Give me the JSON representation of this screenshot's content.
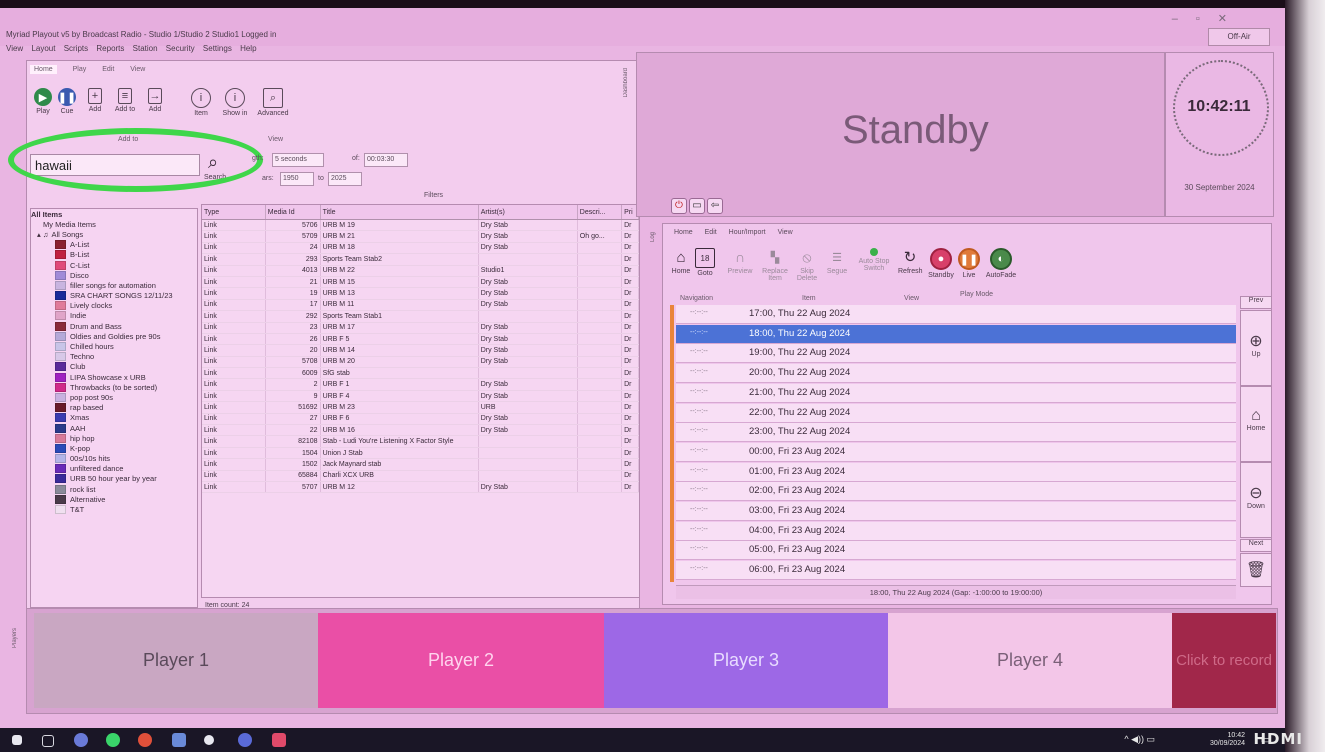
{
  "window": {
    "title": "Myriad Playout v5 by Broadcast Radio - Studio 1/Studio 2 Studio1 Logged in",
    "menu": [
      "View",
      "Layout",
      "Scripts",
      "Reports",
      "Station",
      "Security",
      "Settings",
      "Help"
    ],
    "off_air": "Off-Air"
  },
  "ribbon": {
    "tabs": [
      "Home",
      "Play",
      "Edit",
      "View"
    ],
    "buttons": [
      "Play",
      "Cue",
      "Add",
      "Add to",
      "Add",
      "Item",
      "Show in",
      "Advanced"
    ],
    "buttons_sub": [
      "",
      "",
      "",
      "",
      "",
      "Information",
      "SmartInfo",
      "Search"
    ],
    "groups": [
      "Add to",
      "View"
    ]
  },
  "search": {
    "value": "hawaii",
    "button_label": "Search",
    "all_items_label": "All Items"
  },
  "filters": {
    "length_label": "gth:",
    "length_value": "5 seconds",
    "of_label": "of:",
    "of_value": "00:03:30",
    "years_label": "ars:",
    "year_from": "1950",
    "to_label": "to",
    "year_to": "2025",
    "title": "Filters"
  },
  "tree": {
    "root": "All Items",
    "my_media": "My Media Items",
    "all_songs": "All Songs",
    "items": [
      {
        "label": "A-List",
        "color": "#8a2030"
      },
      {
        "label": "B-List",
        "color": "#c02040"
      },
      {
        "label": "C-List",
        "color": "#e04a7a"
      },
      {
        "label": "Disco",
        "color": "#a08ad8"
      },
      {
        "label": "filler songs for automation",
        "color": "#c8b4e0"
      },
      {
        "label": "SRA CHART SONGS 12/11/23",
        "color": "#1a2a9a"
      },
      {
        "label": "Lively clocks",
        "color": "#e07a9a"
      },
      {
        "label": "Indie",
        "color": "#e0a4c8"
      },
      {
        "label": "Drum and Bass",
        "color": "#8a2a3a"
      },
      {
        "label": "Oldies and Goldies pre 90s",
        "color": "#b4a8d8"
      },
      {
        "label": "Chilled hours",
        "color": "#c8c4e8"
      },
      {
        "label": "Techno",
        "color": "#d8c8e8"
      },
      {
        "label": "Club",
        "color": "#5a2a9a"
      },
      {
        "label": "LIPA Showcase x URB",
        "color": "#a020c0"
      },
      {
        "label": "Throwbacks (to be sorted)",
        "color": "#d02a8a"
      },
      {
        "label": "pop post 90s",
        "color": "#c8b0e0"
      },
      {
        "label": "rap based",
        "color": "#6a1a2a"
      },
      {
        "label": "Xmas",
        "color": "#3a3ab0"
      },
      {
        "label": "AAH",
        "color": "#2a3a8a"
      },
      {
        "label": "hip hop",
        "color": "#d87a9a"
      },
      {
        "label": "K-pop",
        "color": "#2a4ab8"
      },
      {
        "label": "00s/10s hits",
        "color": "#b4b4e8"
      },
      {
        "label": "unfiltered dance",
        "color": "#6a2ab8"
      },
      {
        "label": "URB 50 hour year by year",
        "color": "#3a2a9a"
      },
      {
        "label": "rock list",
        "color": "#8a8a9a"
      },
      {
        "label": "Alternative",
        "color": "#4a3a4a"
      },
      {
        "label": "T&T",
        "color": "#f0e0f0"
      }
    ]
  },
  "grid": {
    "columns": [
      "Type",
      "Media Id",
      "Title",
      "Artist(s)",
      "Descri...",
      "Pri"
    ],
    "rows": [
      [
        "Link",
        "5706",
        "URB M 19",
        "Dry Stab",
        "",
        "Dr"
      ],
      [
        "Link",
        "5709",
        "URB M 21",
        "Dry Stab",
        "Oh go...",
        "Dr"
      ],
      [
        "Link",
        "24",
        "URB M 18",
        "Dry Stab",
        "",
        "Dr"
      ],
      [
        "Link",
        "293",
        "Sports Team Stab2",
        "",
        "",
        "Dr"
      ],
      [
        "Link",
        "4013",
        "URB M 22",
        "Studio1",
        "",
        "Dr"
      ],
      [
        "Link",
        "21",
        "URB M 15",
        "Dry Stab",
        "",
        "Dr"
      ],
      [
        "Link",
        "19",
        "URB M 13",
        "Dry Stab",
        "",
        "Dr"
      ],
      [
        "Link",
        "17",
        "URB M 11",
        "Dry Stab",
        "",
        "Dr"
      ],
      [
        "Link",
        "292",
        "Sports Team Stab1",
        "",
        "",
        "Dr"
      ],
      [
        "Link",
        "23",
        "URB M 17",
        "Dry Stab",
        "",
        "Dr"
      ],
      [
        "Link",
        "26",
        "URB F 5",
        "Dry Stab",
        "",
        "Dr"
      ],
      [
        "Link",
        "20",
        "URB M 14",
        "Dry Stab",
        "",
        "Dr"
      ],
      [
        "Link",
        "5708",
        "URB M 20",
        "Dry Stab",
        "",
        "Dr"
      ],
      [
        "Link",
        "6009",
        "SfG stab",
        "",
        "",
        "Dr"
      ],
      [
        "Link",
        "2",
        "URB F 1",
        "Dry Stab",
        "",
        "Dr"
      ],
      [
        "Link",
        "9",
        "URB F 4",
        "Dry Stab",
        "",
        "Dr"
      ],
      [
        "Link",
        "51692",
        "URB M 23",
        "URB",
        "",
        "Dr"
      ],
      [
        "Link",
        "27",
        "URB F 6",
        "Dry Stab",
        "",
        "Dr"
      ],
      [
        "Link",
        "22",
        "URB M 16",
        "Dry Stab",
        "",
        "Dr"
      ],
      [
        "Link",
        "82108",
        "Stab - Ludi You're Listening X Factor Style",
        "",
        "",
        "Dr"
      ],
      [
        "Link",
        "1504",
        "Union J Stab",
        "",
        "",
        "Dr"
      ],
      [
        "Link",
        "1502",
        "Jack Maynard stab",
        "",
        "",
        "Dr"
      ],
      [
        "Link",
        "65884",
        "Charli XCX URB",
        "",
        "",
        "Dr"
      ],
      [
        "Link",
        "5707",
        "URB M 12",
        "Dry Stab",
        "",
        "Dr"
      ]
    ],
    "item_count": "Item count: 24"
  },
  "dashboard": {
    "tab": "Dashboard",
    "status": "Standby",
    "clock_time": "10:42:11",
    "clock_date": "30 September 2024"
  },
  "log": {
    "tab": "Log",
    "ribbon_tabs": [
      "Home",
      "Edit",
      "Hour/Import",
      "View"
    ],
    "ribbon_buttons": [
      "Home",
      "Goto",
      "Preview",
      "Replace Item",
      "Skip Delete",
      "Segue",
      "Auto Stop Switch",
      "Refresh",
      "Standby",
      "Live",
      "AutoFade"
    ],
    "ribbon_groups": [
      "Navigation",
      "Item",
      "View",
      "Play Mode"
    ],
    "placeholder_time": "--:--:--",
    "rows": [
      "17:00, Thu 22 Aug 2024",
      "18:00, Thu 22 Aug 2024",
      "19:00, Thu 22 Aug 2024",
      "20:00, Thu 22 Aug 2024",
      "21:00, Thu 22 Aug 2024",
      "22:00, Thu 22 Aug 2024",
      "23:00, Thu 22 Aug 2024",
      "00:00, Fri 23 Aug 2024",
      "01:00, Fri 23 Aug 2024",
      "02:00, Fri 23 Aug 2024",
      "03:00, Fri 23 Aug 2024",
      "04:00, Fri 23 Aug 2024",
      "05:00, Fri 23 Aug 2024",
      "06:00, Fri 23 Aug 2024"
    ],
    "status_bar": "18:00, Thu 22 Aug 2024 (Gap: -1:00:00 to 19:00:00)",
    "side": {
      "prev": "Prev",
      "up": "Up",
      "home": "Home",
      "down": "Down",
      "next": "Next"
    }
  },
  "players": {
    "tab": "Players",
    "items": [
      {
        "label": "Player 1",
        "color": "#c9a7c2",
        "text_color": "#5a4a5a"
      },
      {
        "label": "Player 2",
        "color": "#ea4fa6",
        "text_color": "#ffd4ee"
      },
      {
        "label": "Player 3",
        "color": "#9d68e6",
        "text_color": "#e8dcff"
      },
      {
        "label": "Player 4",
        "color": "#f3c6e8",
        "text_color": "#7a6078"
      }
    ],
    "record": {
      "label": "Click to record",
      "color": "#a1274a"
    }
  },
  "taskbar": {
    "time": "10:42",
    "date": "30/09/2024"
  },
  "monitor": {
    "brand": "HDMI"
  }
}
